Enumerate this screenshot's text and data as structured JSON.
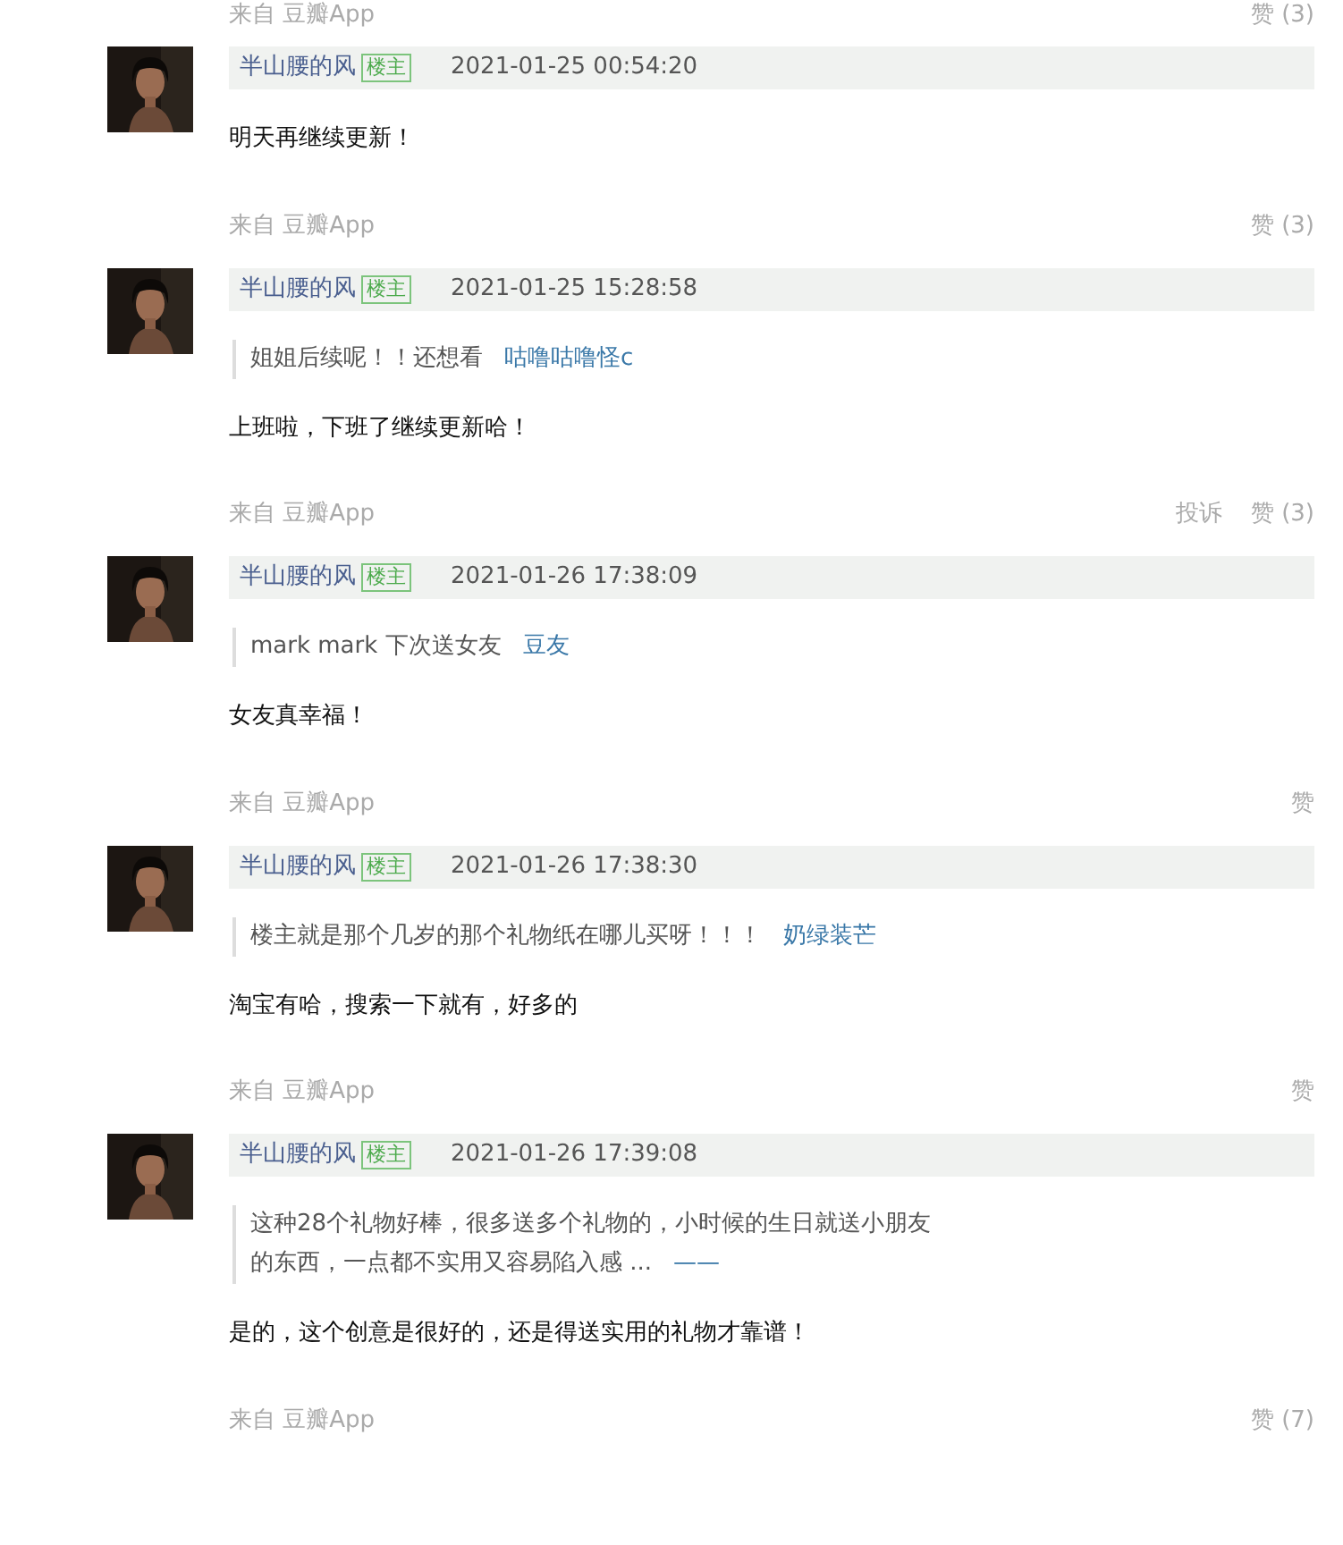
{
  "leading_footer": {
    "source": "来自 豆瓣App",
    "likes": "赞 (3)"
  },
  "comments": [
    {
      "author": "半山腰的风",
      "badge": "楼主",
      "time": "2021-01-25 00:54:20",
      "body": "明天再继续更新！",
      "footer": {
        "source": "来自 豆瓣App",
        "likes": "赞 (3)"
      }
    },
    {
      "author": "半山腰的风",
      "badge": "楼主",
      "time": "2021-01-25 15:28:58",
      "quote": {
        "lines": [
          "姐姐后续呢！！还想看"
        ],
        "author": "咕噜咕噜怪c"
      },
      "body": "上班啦，下班了继续更新哈！",
      "footer": {
        "source": "来自 豆瓣App",
        "report": "投诉",
        "likes": "赞 (3)"
      }
    },
    {
      "author": "半山腰的风",
      "badge": "楼主",
      "time": "2021-01-26 17:38:09",
      "quote": {
        "lines": [
          "mark mark 下次送女友"
        ],
        "author": "豆友"
      },
      "body": "女友真幸福！",
      "footer": {
        "source": "来自 豆瓣App",
        "likes": "赞"
      }
    },
    {
      "author": "半山腰的风",
      "badge": "楼主",
      "time": "2021-01-26 17:38:30",
      "quote": {
        "lines": [
          "楼主就是那个几岁的那个礼物纸在哪儿买呀！！！"
        ],
        "author": "奶绿装芒"
      },
      "body": "淘宝有哈，搜索一下就有，好多的",
      "footer": {
        "source": "来自 豆瓣App",
        "likes": "赞"
      }
    },
    {
      "author": "半山腰的风",
      "badge": "楼主",
      "time": "2021-01-26 17:39:08",
      "quote": {
        "lines": [
          "这种28个礼物好棒，很多送多个礼物的，小时候的生日就送小朋友",
          "的东西，一点都不实用又容易陷入感 ..."
        ],
        "author": "——"
      },
      "body": "是的，这个创意是很好的，还是得送实用的礼物才靠谱！",
      "footer": {
        "source": "来自 豆瓣App",
        "likes": "赞 (7)"
      }
    }
  ]
}
